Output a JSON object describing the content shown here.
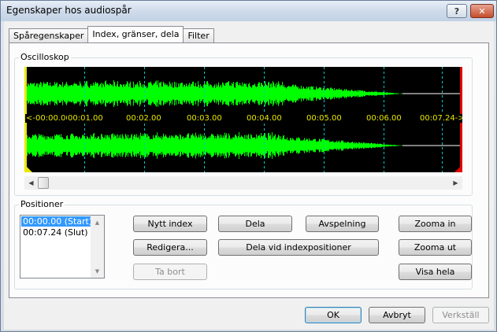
{
  "window": {
    "title": "Egenskaper hos audiospår",
    "help_glyph": "?",
    "close_glyph": "✕"
  },
  "tabs": [
    {
      "label": "Spåregenskaper",
      "active": false
    },
    {
      "label": "Index, gränser, dela",
      "active": true
    },
    {
      "label": "Filter",
      "active": false
    }
  ],
  "oscilloscope": {
    "label": "Oscilloskop",
    "time_labels": [
      "<-00:00.00",
      "00:01.00",
      "00:02.00",
      "00:03.00",
      "00:04.00",
      "00:05.00",
      "00:06.00",
      "00:07.24->"
    ],
    "colors": {
      "background": "#000000",
      "wave": "#00ff00",
      "time": "#e8e800",
      "start_marker": "#e8e800",
      "end_marker": "#e00000",
      "gridline": "#00c8c8"
    }
  },
  "positions": {
    "label": "Positioner",
    "items": [
      {
        "label": "00:00.00 (Start)",
        "selected": true
      },
      {
        "label": "00:07.24 (Slut)",
        "selected": false
      }
    ]
  },
  "buttons": {
    "new_index": "Nytt index",
    "edit": "Redigera...",
    "delete": "Ta bort",
    "split": "Dela",
    "split_at_index": "Dela vid indexpositioner",
    "playback": "Avspelning",
    "zoom_in": "Zooma in",
    "zoom_out": "Zooma ut",
    "show_all": "Visa hela",
    "ok": "OK",
    "cancel": "Avbryt",
    "apply": "Verkställ"
  }
}
